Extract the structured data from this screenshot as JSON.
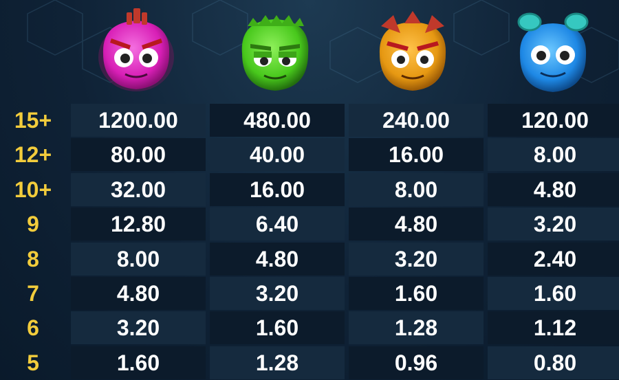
{
  "symbols": [
    {
      "name": "pink-monster-icon",
      "color": "#d81fb6"
    },
    {
      "name": "green-monster-icon",
      "color": "#48c81c"
    },
    {
      "name": "orange-monster-icon",
      "color": "#e69812"
    },
    {
      "name": "blue-monster-icon",
      "color": "#1e88e5"
    }
  ],
  "colors": {
    "count_label": "#f2cc3c",
    "payout_text": "#ffffff",
    "row_dark": "#0c1b2b",
    "row_light": "#152a3e"
  },
  "paytable": [
    {
      "count": "15+",
      "payouts": [
        "1200.00",
        "480.00",
        "240.00",
        "120.00"
      ]
    },
    {
      "count": "12+",
      "payouts": [
        "80.00",
        "40.00",
        "16.00",
        "8.00"
      ]
    },
    {
      "count": "10+",
      "payouts": [
        "32.00",
        "16.00",
        "8.00",
        "4.80"
      ]
    },
    {
      "count": "9",
      "payouts": [
        "12.80",
        "6.40",
        "4.80",
        "3.20"
      ]
    },
    {
      "count": "8",
      "payouts": [
        "8.00",
        "4.80",
        "3.20",
        "2.40"
      ]
    },
    {
      "count": "7",
      "payouts": [
        "4.80",
        "3.20",
        "1.60",
        "1.60"
      ]
    },
    {
      "count": "6",
      "payouts": [
        "3.20",
        "1.60",
        "1.28",
        "1.12"
      ]
    },
    {
      "count": "5",
      "payouts": [
        "1.60",
        "1.28",
        "0.96",
        "0.80"
      ]
    }
  ]
}
